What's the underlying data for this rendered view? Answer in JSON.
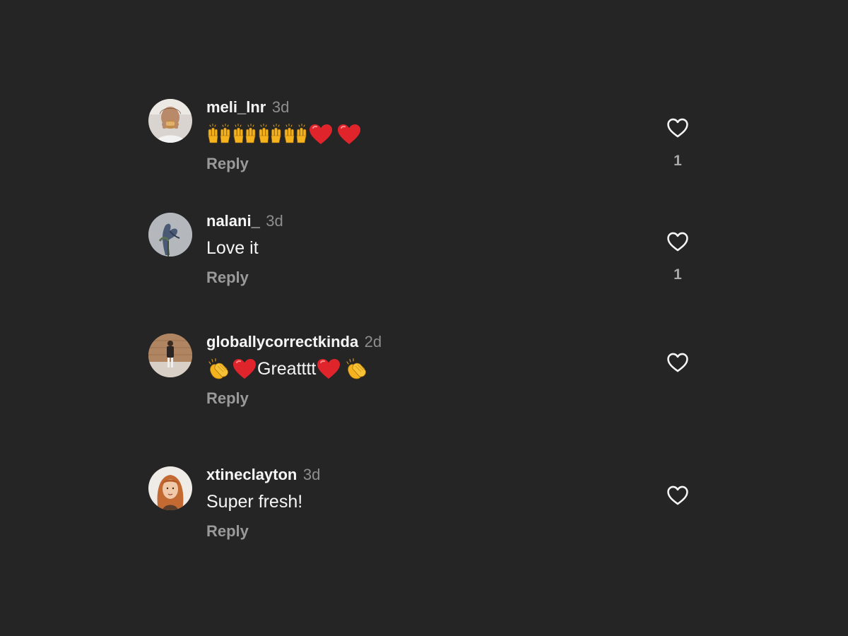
{
  "comments": [
    {
      "username": "meli_lnr",
      "time": "3d",
      "text_emojis": [
        "raising-hands",
        "raising-hands",
        "raising-hands",
        "raising-hands",
        "red-heart",
        "red-heart"
      ],
      "reply_label": "Reply",
      "likes": "1"
    },
    {
      "username": "nalani_",
      "time": "3d",
      "text": "Love it",
      "reply_label": "Reply",
      "likes": "1"
    },
    {
      "username": "globallycorrectkinda",
      "time": "2d",
      "text_before": "",
      "text_word": "Greatttt",
      "text_emojis": [
        "clapping-hands",
        "red-heart",
        "red-heart",
        "clapping-hands"
      ],
      "reply_label": "Reply",
      "likes": ""
    },
    {
      "username": "xtineclayton",
      "time": "3d",
      "text": "Super fresh!",
      "reply_label": "Reply",
      "likes": ""
    }
  ],
  "icons": {
    "like": "heart-outline-icon",
    "avatar": "user-avatar"
  },
  "colors": {
    "background": "#252525",
    "text": "#f5f5f5",
    "muted": "#8e8e8e",
    "heart_emoji": "#e0242c",
    "hands_emoji": "#f5b21c"
  }
}
